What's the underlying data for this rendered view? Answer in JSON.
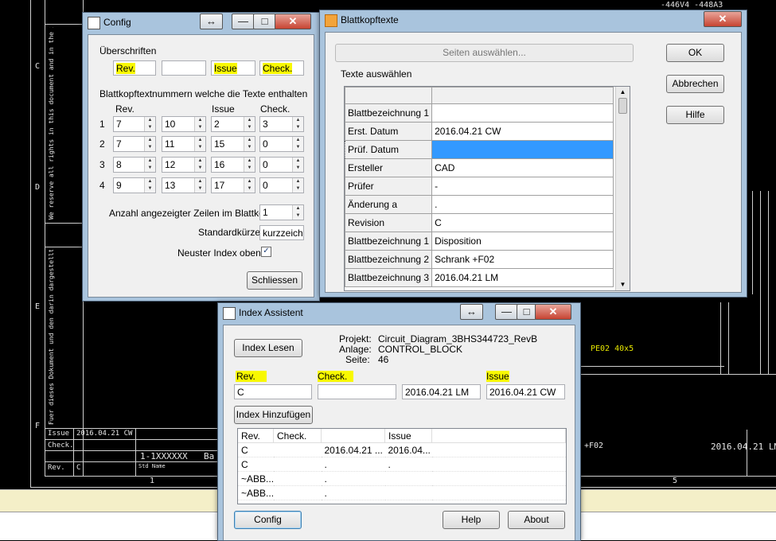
{
  "cad": {
    "row_letters": [
      "C",
      "D",
      "E",
      "F"
    ],
    "col_numbers": [
      "1",
      "5"
    ],
    "coords": "-446V4 -448A3",
    "pe_label": "PE02 40x5",
    "plus_label": "+F02",
    "date_right": "2016.04.21 LM",
    "titleblock": {
      "issue_label": "Issue",
      "issue_value": "2016.04.21 CW",
      "check_label": "Check.",
      "rev_label": "Rev.",
      "rev_value": "C",
      "doc_no": "1-1XXXXXX",
      "doc_suffix": "Ba",
      "std_name": "Std Name"
    },
    "copyright_text_1": "We reserve all rights in this document and in the information contained therein. Reproduction, use or disclosure to third parties without express authority is strictly forbidden. Copyright 2016 ABB. All rights reserved.",
    "copyright_text_2": "Fuer dieses Dokument und den darin dargestellten Gegenstand behalten wir uns alle Rechte vor. Vervielfaeltigung, Bekanntgabe an Dritte oder Verwertung seines Inhaltes sind ohne unsere ausdrueckliche Zustimmung verboten. Copyright 2016 ABB. All rights reserved."
  },
  "config": {
    "title": "Config",
    "section_headers": "Überschriften",
    "header_fields": [
      "Rev.",
      "",
      "Issue",
      "Check."
    ],
    "section_numbers": "Blattkopftextnummern welche die Texte enthalten",
    "col_headers": [
      "Rev.",
      "",
      "Issue",
      "Check."
    ],
    "rows": [
      {
        "num": "1",
        "values": [
          "7",
          "10",
          "2",
          "3"
        ]
      },
      {
        "num": "2",
        "values": [
          "7",
          "11",
          "15",
          "0"
        ]
      },
      {
        "num": "3",
        "values": [
          "8",
          "12",
          "16",
          "0"
        ]
      },
      {
        "num": "4",
        "values": [
          "9",
          "13",
          "17",
          "0"
        ]
      }
    ],
    "anzahl_label": "Anzahl angezeigter Zeilen im Blattkopf",
    "anzahl_value": "1",
    "kuerzel_label": "Standardkürzel",
    "kuerzel_value": "kurzzeiche",
    "neuster_label": "Neuster Index oben",
    "neuster_checked": "✓",
    "close_button": "Schliessen"
  },
  "blattkopf": {
    "title": "Blattkopftexte",
    "seiten_button": "Seiten auswählen...",
    "group_label": "Texte auswählen",
    "ok_button": "OK",
    "cancel_button": "Abbrechen",
    "help_button": "Hilfe",
    "rows": [
      {
        "name": "Blattbezeichnung 1",
        "value": ""
      },
      {
        "name": "Erst. Datum",
        "value": "2016.04.21 CW"
      },
      {
        "name": "Prüf. Datum",
        "value": ""
      },
      {
        "name": "Ersteller",
        "value": "CAD"
      },
      {
        "name": "Prüfer",
        "value": "-"
      },
      {
        "name": "Änderung a",
        "value": "."
      },
      {
        "name": "Revision",
        "value": "C"
      },
      {
        "name": "Blattbezeichnung 1",
        "value": "Disposition"
      },
      {
        "name": "Blattbezeichnung 2",
        "value": "Schrank +F02"
      },
      {
        "name": "Blattbezeichnung 3",
        "value": "2016.04.21 LM"
      }
    ],
    "selected_color": "#3399ff"
  },
  "index": {
    "title": "Index Assistent",
    "lesen_button": "Index Lesen",
    "projekt_label": "Projekt:",
    "projekt_value": "Circuit_Diagram_3BHS344723_RevB",
    "anlage_label": "Anlage:",
    "anlage_value": "CONTROL_BLOCK",
    "seite_label": "Seite:",
    "seite_value": "46",
    "rev_label": "Rev.",
    "check_label": "Check.",
    "issue_label": "Issue",
    "rev_value": "C",
    "check_value": "",
    "date1_value": "2016.04.21 LM",
    "issue_value": "2016.04.21 CW",
    "add_button": "Index Hinzufügen",
    "list_headers": [
      "Rev.",
      "Check.",
      "",
      "Issue",
      ""
    ],
    "list_rows": [
      [
        "C",
        "",
        "2016.04.21 ...",
        "2016.04...",
        ""
      ],
      [
        "C",
        "",
        ".",
        ".",
        ""
      ],
      [
        "~ABB...",
        "",
        ".",
        "",
        ""
      ],
      [
        "~ABB...",
        "",
        ".",
        "",
        ""
      ]
    ],
    "config_button": "Config",
    "help_button": "Help",
    "about_button": "About"
  },
  "colors": {
    "highlight": "#f8f800",
    "titlebar": "#a9c4dd"
  }
}
